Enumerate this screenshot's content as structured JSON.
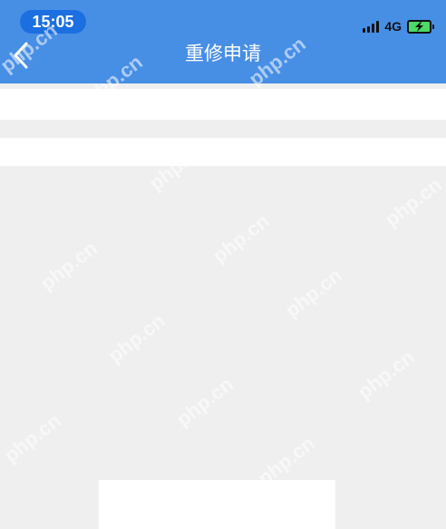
{
  "status_bar": {
    "time": "15:05",
    "network": "4G",
    "battery_charging": true
  },
  "nav": {
    "back_icon": "chevron-left-icon",
    "title": "重修申请"
  },
  "form": {
    "row_1_text": "",
    "row_2_text": ""
  },
  "footer": {
    "button_label": ""
  },
  "watermark": "php.cn",
  "colors": {
    "nav_background": "#478ee5",
    "time_pill": "#1b6fe0",
    "page_background": "#efefef",
    "battery": "#4cd964"
  }
}
